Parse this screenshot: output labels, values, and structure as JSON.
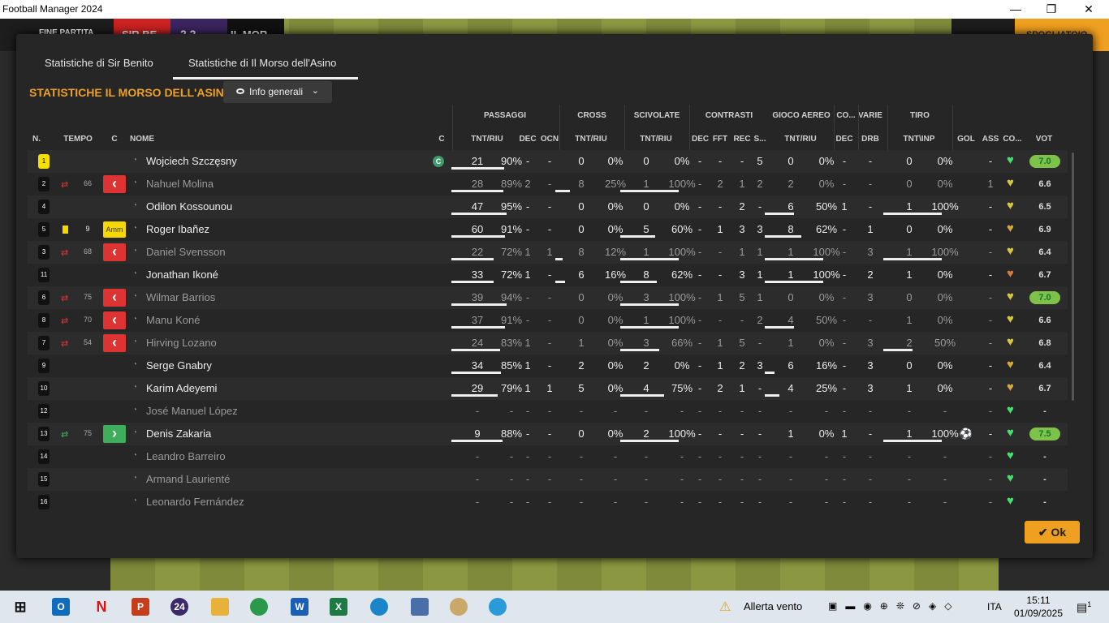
{
  "window": {
    "title": "Football Manager 2024"
  },
  "topbar": {
    "end_label": "FINE PARTITA",
    "team1": "SIR BE",
    "score": "2  2",
    "team2": "IL MOR",
    "skip_label": "SPOGLIATOIO"
  },
  "tabs": [
    {
      "label": "Statistiche di Sir Benito"
    },
    {
      "label": "Statistiche di Il Morso dell'Asino"
    }
  ],
  "section": {
    "title": "STATISTICHE IL MORSO DELL'ASINO",
    "view": "Info generali"
  },
  "groups": {
    "passaggi": "PASSAGGI",
    "cross": "CROSS",
    "scivolate": "SCIVOLATE",
    "contrasti": "CONTRASTI",
    "gioco_aereo": "GIOCO AEREO",
    "co": "CO...",
    "varie": "VARIE",
    "tiro": "TIRO"
  },
  "columns": {
    "n": "N.",
    "tempo": "TEMPO",
    "c": "C",
    "nome": "NOME",
    "c2": "C",
    "pass_tnt": "TNT/RIU",
    "pass_dec": "DEC",
    "pass_ocn": "OCN",
    "cross_tnt": "TNT/RIU",
    "sciv_tnt": "TNT/RIU",
    "con_dec": "DEC",
    "con_fft": "FFT",
    "con_rec": "REC",
    "con_s": "S...",
    "aer_tnt": "TNT/RIU",
    "co_dec": "DEC",
    "varie_drb": "DRB",
    "tiro_tnt": "TNT\\INP",
    "gol": "GOL",
    "ass": "ASS",
    "cond": "CO...",
    "vot": "VOT"
  },
  "players": [
    {
      "num": "1",
      "gk": true,
      "min": "",
      "status": "",
      "name": "Wojciech Szczęsny",
      "captain": "C",
      "pass": [
        "21",
        "90%"
      ],
      "pdec": "-",
      "pocn": "-",
      "cross": [
        "0",
        "0%"
      ],
      "sciv": [
        "0",
        "0%"
      ],
      "cdec": "-",
      "fft": "-",
      "rec": "-",
      "s": "5",
      "aer": [
        "0",
        "0%"
      ],
      "codec": "-",
      "drb": "-",
      "tiro": [
        "0",
        "0%"
      ],
      "gol": "",
      "ass": "-",
      "heart": "#3fe36a",
      "vot": "7.0",
      "good": true,
      "dim": false
    },
    {
      "num": "2",
      "arrow": "out",
      "min": "66",
      "status": "out",
      "name": "Nahuel Molina",
      "pass": [
        "28",
        "89%"
      ],
      "pdec": "2",
      "pocn": "-",
      "cross": [
        "8",
        "25%"
      ],
      "sciv": [
        "1",
        "100%"
      ],
      "cdec": "-",
      "fft": "2",
      "rec": "1",
      "s": "2",
      "aer": [
        "2",
        "0%"
      ],
      "codec": "-",
      "drb": "-",
      "tiro": [
        "0",
        "0%"
      ],
      "gol": "",
      "ass": "1",
      "heart": "#d7c63a",
      "vot": "6.6",
      "good": false,
      "dim": true
    },
    {
      "num": "4",
      "min": "",
      "status": "",
      "name": "Odilon Kossounou",
      "pass": [
        "47",
        "95%"
      ],
      "pdec": "-",
      "pocn": "-",
      "cross": [
        "0",
        "0%"
      ],
      "sciv": [
        "0",
        "0%"
      ],
      "cdec": "-",
      "fft": "-",
      "rec": "2",
      "s": "-",
      "aer": [
        "6",
        "50%"
      ],
      "codec": "1",
      "drb": "-",
      "tiro": [
        "1",
        "100%"
      ],
      "gol": "",
      "ass": "-",
      "heart": "#d7c63a",
      "vot": "6.5",
      "good": false,
      "dim": false
    },
    {
      "num": "5",
      "card": true,
      "min": "9",
      "status": "amm",
      "status_label": "Amm",
      "name": "Roger Ibañez",
      "pass": [
        "60",
        "91%"
      ],
      "pdec": "-",
      "pocn": "-",
      "cross": [
        "0",
        "0%"
      ],
      "sciv": [
        "5",
        "60%"
      ],
      "cdec": "-",
      "fft": "1",
      "rec": "3",
      "s": "3",
      "aer": [
        "8",
        "62%"
      ],
      "codec": "-",
      "drb": "1",
      "tiro": [
        "0",
        "0%"
      ],
      "gol": "",
      "ass": "-",
      "heart": "#d7a83a",
      "vot": "6.9",
      "good": false,
      "dim": false
    },
    {
      "num": "3",
      "arrow": "out",
      "min": "68",
      "status": "out",
      "name": "Daniel Svensson",
      "pass": [
        "22",
        "72%"
      ],
      "pdec": "1",
      "pocn": "1",
      "cross": [
        "8",
        "12%"
      ],
      "sciv": [
        "1",
        "100%"
      ],
      "cdec": "-",
      "fft": "-",
      "rec": "1",
      "s": "1",
      "aer": [
        "1",
        "100%"
      ],
      "codec": "-",
      "drb": "3",
      "tiro": [
        "1",
        "100%"
      ],
      "gol": "",
      "ass": "-",
      "heart": "#d7c63a",
      "vot": "6.4",
      "good": false,
      "dim": true
    },
    {
      "num": "11",
      "min": "",
      "status": "",
      "name": "Jonathan Ikoné",
      "pass": [
        "33",
        "72%"
      ],
      "pdec": "1",
      "pocn": "-",
      "cross": [
        "6",
        "16%"
      ],
      "sciv": [
        "8",
        "62%"
      ],
      "cdec": "-",
      "fft": "-",
      "rec": "3",
      "s": "1",
      "aer": [
        "1",
        "100%"
      ],
      "codec": "-",
      "drb": "2",
      "tiro": [
        "1",
        "0%"
      ],
      "gol": "",
      "ass": "-",
      "heart": "#d77a3a",
      "vot": "6.7",
      "good": false,
      "dim": false
    },
    {
      "num": "6",
      "arrow": "out",
      "min": "75",
      "status": "out",
      "name": "Wilmar Barrios",
      "pass": [
        "39",
        "94%"
      ],
      "pdec": "-",
      "pocn": "-",
      "cross": [
        "0",
        "0%"
      ],
      "sciv": [
        "3",
        "100%"
      ],
      "cdec": "-",
      "fft": "1",
      "rec": "5",
      "s": "1",
      "aer": [
        "0",
        "0%"
      ],
      "codec": "-",
      "drb": "3",
      "tiro": [
        "0",
        "0%"
      ],
      "gol": "",
      "ass": "-",
      "heart": "#d7c63a",
      "vot": "7.0",
      "good": true,
      "dim": true
    },
    {
      "num": "8",
      "arrow": "out",
      "min": "70",
      "status": "out",
      "name": "Manu Koné",
      "pass": [
        "37",
        "91%"
      ],
      "pdec": "-",
      "pocn": "-",
      "cross": [
        "0",
        "0%"
      ],
      "sciv": [
        "1",
        "100%"
      ],
      "cdec": "-",
      "fft": "-",
      "rec": "-",
      "s": "2",
      "aer": [
        "4",
        "50%"
      ],
      "codec": "-",
      "drb": "-",
      "tiro": [
        "1",
        "0%"
      ],
      "gol": "",
      "ass": "-",
      "heart": "#d7c63a",
      "vot": "6.6",
      "good": false,
      "dim": true
    },
    {
      "num": "7",
      "arrow": "out",
      "min": "54",
      "status": "out",
      "name": "Hirving Lozano",
      "pass": [
        "24",
        "83%"
      ],
      "pdec": "1",
      "pocn": "-",
      "cross": [
        "1",
        "0%"
      ],
      "sciv": [
        "3",
        "66%"
      ],
      "cdec": "-",
      "fft": "1",
      "rec": "5",
      "s": "-",
      "aer": [
        "1",
        "0%"
      ],
      "codec": "-",
      "drb": "3",
      "tiro": [
        "2",
        "50%"
      ],
      "gol": "",
      "ass": "-",
      "heart": "#d7c63a",
      "vot": "6.8",
      "good": false,
      "dim": true
    },
    {
      "num": "9",
      "min": "",
      "status": "",
      "name": "Serge Gnabry",
      "pass": [
        "34",
        "85%"
      ],
      "pdec": "1",
      "pocn": "-",
      "cross": [
        "2",
        "0%"
      ],
      "sciv": [
        "2",
        "0%"
      ],
      "cdec": "-",
      "fft": "1",
      "rec": "2",
      "s": "3",
      "aer": [
        "6",
        "16%"
      ],
      "codec": "-",
      "drb": "3",
      "tiro": [
        "0",
        "0%"
      ],
      "gol": "",
      "ass": "-",
      "heart": "#d7a83a",
      "vot": "6.4",
      "good": false,
      "dim": false
    },
    {
      "num": "10",
      "min": "",
      "status": "",
      "name": "Karim Adeyemi",
      "pass": [
        "29",
        "79%"
      ],
      "pdec": "1",
      "pocn": "1",
      "cross": [
        "5",
        "0%"
      ],
      "sciv": [
        "4",
        "75%"
      ],
      "cdec": "-",
      "fft": "2",
      "rec": "1",
      "s": "-",
      "aer": [
        "4",
        "25%"
      ],
      "codec": "-",
      "drb": "3",
      "tiro": [
        "1",
        "0%"
      ],
      "gol": "",
      "ass": "-",
      "heart": "#d7a83a",
      "vot": "6.7",
      "good": false,
      "dim": false
    },
    {
      "num": "12",
      "min": "",
      "status": "",
      "name": "José Manuel López",
      "pass": [
        "-",
        "-"
      ],
      "pdec": "-",
      "pocn": "-",
      "cross": [
        "-",
        "-"
      ],
      "sciv": [
        "-",
        "-"
      ],
      "cdec": "-",
      "fft": "-",
      "rec": "-",
      "s": "-",
      "aer": [
        "-",
        "-"
      ],
      "codec": "-",
      "drb": "-",
      "tiro": [
        "-",
        "-"
      ],
      "gol": "",
      "ass": "-",
      "heart": "#3fe36a",
      "vot": "-",
      "good": false,
      "dim": true
    },
    {
      "num": "13",
      "arrow": "in",
      "min": "75",
      "status": "in",
      "name": "Denis Zakaria",
      "pass": [
        "9",
        "88%"
      ],
      "pdec": "-",
      "pocn": "-",
      "cross": [
        "0",
        "0%"
      ],
      "sciv": [
        "2",
        "100%"
      ],
      "cdec": "-",
      "fft": "-",
      "rec": "-",
      "s": "-",
      "aer": [
        "1",
        "0%"
      ],
      "codec": "1",
      "drb": "-",
      "tiro": [
        "1",
        "100%"
      ],
      "gol": "⚽",
      "ass": "-",
      "heart": "#3fe36a",
      "vot": "7.5",
      "good": true,
      "dim": false
    },
    {
      "num": "14",
      "min": "",
      "status": "",
      "name": "Leandro Barreiro",
      "pass": [
        "-",
        "-"
      ],
      "pdec": "-",
      "pocn": "-",
      "cross": [
        "-",
        "-"
      ],
      "sciv": [
        "-",
        "-"
      ],
      "cdec": "-",
      "fft": "-",
      "rec": "-",
      "s": "-",
      "aer": [
        "-",
        "-"
      ],
      "codec": "-",
      "drb": "-",
      "tiro": [
        "-",
        "-"
      ],
      "gol": "",
      "ass": "-",
      "heart": "#3fe36a",
      "vot": "-",
      "good": false,
      "dim": true
    },
    {
      "num": "15",
      "min": "",
      "status": "",
      "name": "Armand Laurienté",
      "pass": [
        "-",
        "-"
      ],
      "pdec": "-",
      "pocn": "-",
      "cross": [
        "-",
        "-"
      ],
      "sciv": [
        "-",
        "-"
      ],
      "cdec": "-",
      "fft": "-",
      "rec": "-",
      "s": "-",
      "aer": [
        "-",
        "-"
      ],
      "codec": "-",
      "drb": "-",
      "tiro": [
        "-",
        "-"
      ],
      "gol": "",
      "ass": "-",
      "heart": "#3fe36a",
      "vot": "-",
      "good": false,
      "dim": true
    },
    {
      "num": "16",
      "min": "",
      "status": "",
      "name": "Leonardo Fernández",
      "pass": [
        "-",
        "-"
      ],
      "pdec": "-",
      "pocn": "-",
      "cross": [
        "-",
        "-"
      ],
      "sciv": [
        "-",
        "-"
      ],
      "cdec": "-",
      "fft": "-",
      "rec": "-",
      "s": "-",
      "aer": [
        "-",
        "-"
      ],
      "codec": "-",
      "drb": "-",
      "tiro": [
        "-",
        "-"
      ],
      "gol": "",
      "ass": "-",
      "heart": "#3fe36a",
      "vot": "-",
      "good": false,
      "dim": true
    }
  ],
  "ok_label": "Ok",
  "taskbar": {
    "weather": "Allerta vento",
    "lang": "ITA",
    "time": "15:11",
    "date": "01/09/2025",
    "fm_label": "24",
    "notif": "1"
  }
}
